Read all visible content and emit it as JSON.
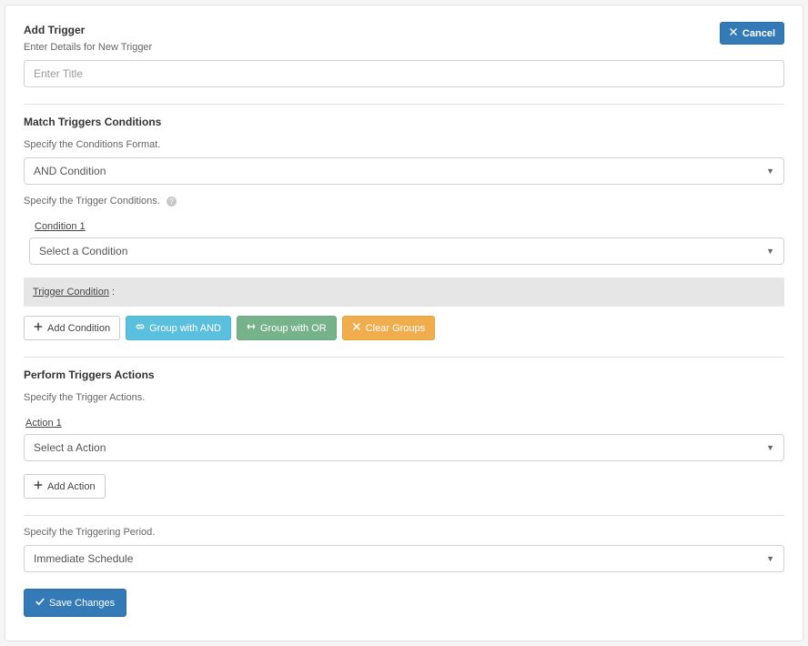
{
  "header": {
    "title": "Add Trigger",
    "subtitle": "Enter Details for New Trigger",
    "cancel_label": "Cancel",
    "title_placeholder": "Enter Title"
  },
  "match": {
    "heading": "Match Triggers Conditions",
    "format_label": "Specify the Conditions Format.",
    "format_value": "AND Condition",
    "conditions_label": "Specify the Trigger Conditions.",
    "conditions": [
      {
        "label": "Condition 1",
        "value": "Select a Condition"
      }
    ],
    "trigger_condition_label": "Trigger Condition",
    "trigger_condition_suffix": " :",
    "buttons": {
      "add_condition": "Add Condition",
      "group_and": "Group with AND",
      "group_or": "Group with OR",
      "clear_groups": "Clear Groups"
    }
  },
  "actions": {
    "heading": "Perform Triggers Actions",
    "specify_label": "Specify the Trigger Actions.",
    "items": [
      {
        "label": "Action 1",
        "value": "Select a Action"
      }
    ],
    "add_action_label": "Add Action"
  },
  "period": {
    "label": "Specify the Triggering Period.",
    "value": "Immediate Schedule"
  },
  "save_label": "Save Changes"
}
